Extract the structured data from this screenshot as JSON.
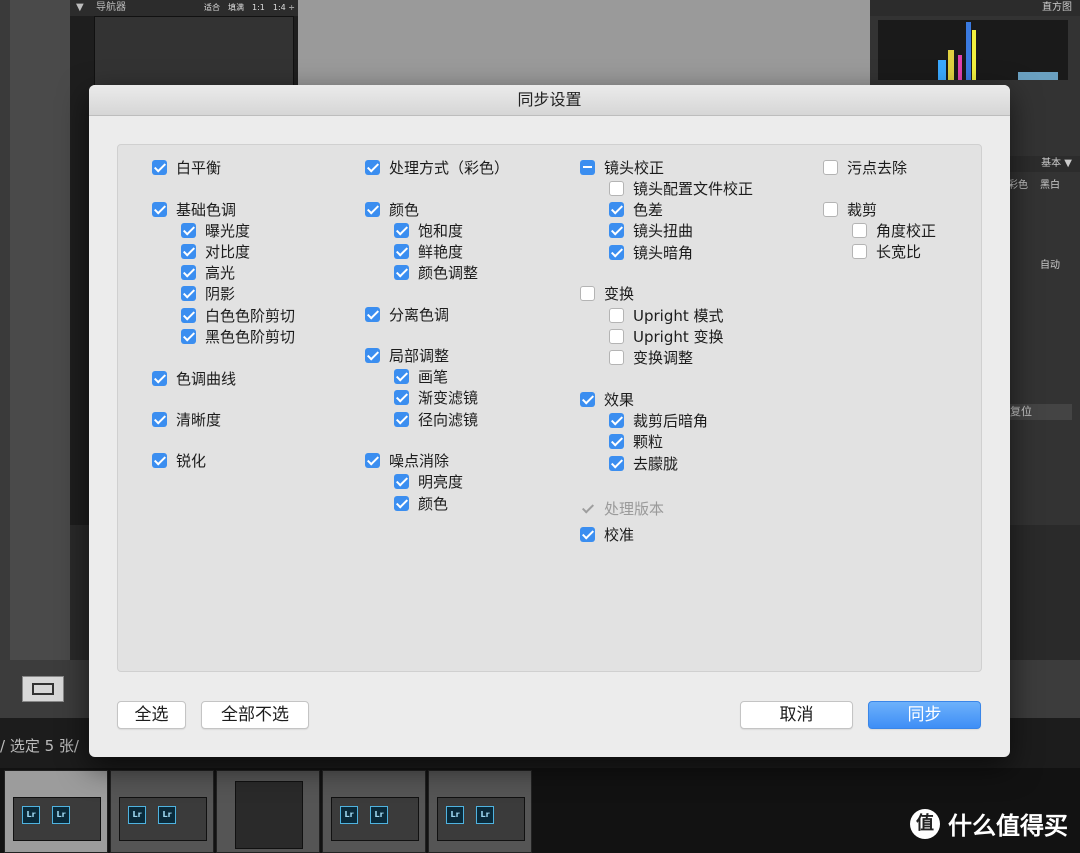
{
  "background": {
    "navigator": {
      "title": "导航器",
      "options": "适合　填满　1:1　1:4 ÷"
    },
    "right_panel": {
      "histogram_title": "直方图",
      "basic_title": "基本 ▼",
      "color_label": "彩色",
      "bw_label": "黑白",
      "auto_label": "自动",
      "reset_label": "复位"
    },
    "status_text": "/ 选定 5 张/",
    "film_lr_label": "Lr",
    "watermark": {
      "icon": "值",
      "text": "什么值得买"
    }
  },
  "dialog": {
    "title": "同步设置",
    "columns": [
      [
        {
          "label": "白平衡",
          "state": "checked"
        },
        {
          "label": "基础色调",
          "state": "checked"
        },
        {
          "label": "曝光度",
          "state": "checked"
        },
        {
          "label": "对比度",
          "state": "checked"
        },
        {
          "label": "高光",
          "state": "checked"
        },
        {
          "label": "阴影",
          "state": "checked"
        },
        {
          "label": "白色色阶剪切",
          "state": "checked"
        },
        {
          "label": "黑色色阶剪切",
          "state": "checked"
        },
        {
          "label": "色调曲线",
          "state": "checked"
        },
        {
          "label": "清晰度",
          "state": "checked"
        },
        {
          "label": "锐化",
          "state": "checked"
        }
      ],
      [
        {
          "label": "处理方式（彩色）",
          "state": "checked"
        },
        {
          "label": "颜色",
          "state": "checked"
        },
        {
          "label": "饱和度",
          "state": "checked"
        },
        {
          "label": "鲜艳度",
          "state": "checked"
        },
        {
          "label": "颜色调整",
          "state": "checked"
        },
        {
          "label": "分离色调",
          "state": "checked"
        },
        {
          "label": "局部调整",
          "state": "checked"
        },
        {
          "label": "画笔",
          "state": "checked"
        },
        {
          "label": "渐变滤镜",
          "state": "checked"
        },
        {
          "label": "径向滤镜",
          "state": "checked"
        },
        {
          "label": "噪点消除",
          "state": "checked"
        },
        {
          "label": "明亮度",
          "state": "checked"
        },
        {
          "label": "颜色",
          "state": "checked"
        }
      ],
      [
        {
          "label": "镜头校正",
          "state": "mixed"
        },
        {
          "label": "镜头配置文件校正",
          "state": "unchecked"
        },
        {
          "label": "色差",
          "state": "checked"
        },
        {
          "label": "镜头扭曲",
          "state": "checked"
        },
        {
          "label": "镜头暗角",
          "state": "checked"
        },
        {
          "label": "变换",
          "state": "unchecked"
        },
        {
          "label": "Upright 模式",
          "state": "unchecked"
        },
        {
          "label": "Upright 变换",
          "state": "unchecked"
        },
        {
          "label": "变换调整",
          "state": "unchecked"
        },
        {
          "label": "效果",
          "state": "checked"
        },
        {
          "label": "裁剪后暗角",
          "state": "checked"
        },
        {
          "label": "颗粒",
          "state": "checked"
        },
        {
          "label": "去朦胧",
          "state": "checked"
        },
        {
          "label": "处理版本",
          "state": "disabled"
        },
        {
          "label": "校准",
          "state": "checked"
        }
      ],
      [
        {
          "label": "污点去除",
          "state": "unchecked"
        },
        {
          "label": "裁剪",
          "state": "unchecked"
        },
        {
          "label": "角度校正",
          "state": "unchecked"
        },
        {
          "label": "长宽比",
          "state": "unchecked"
        }
      ]
    ],
    "buttons": {
      "select_all": "全选",
      "select_none": "全部不选",
      "cancel": "取消",
      "sync": "同步"
    },
    "colors": {
      "accent": "#3b8ef0",
      "dialog_bg": "#ececec"
    }
  }
}
